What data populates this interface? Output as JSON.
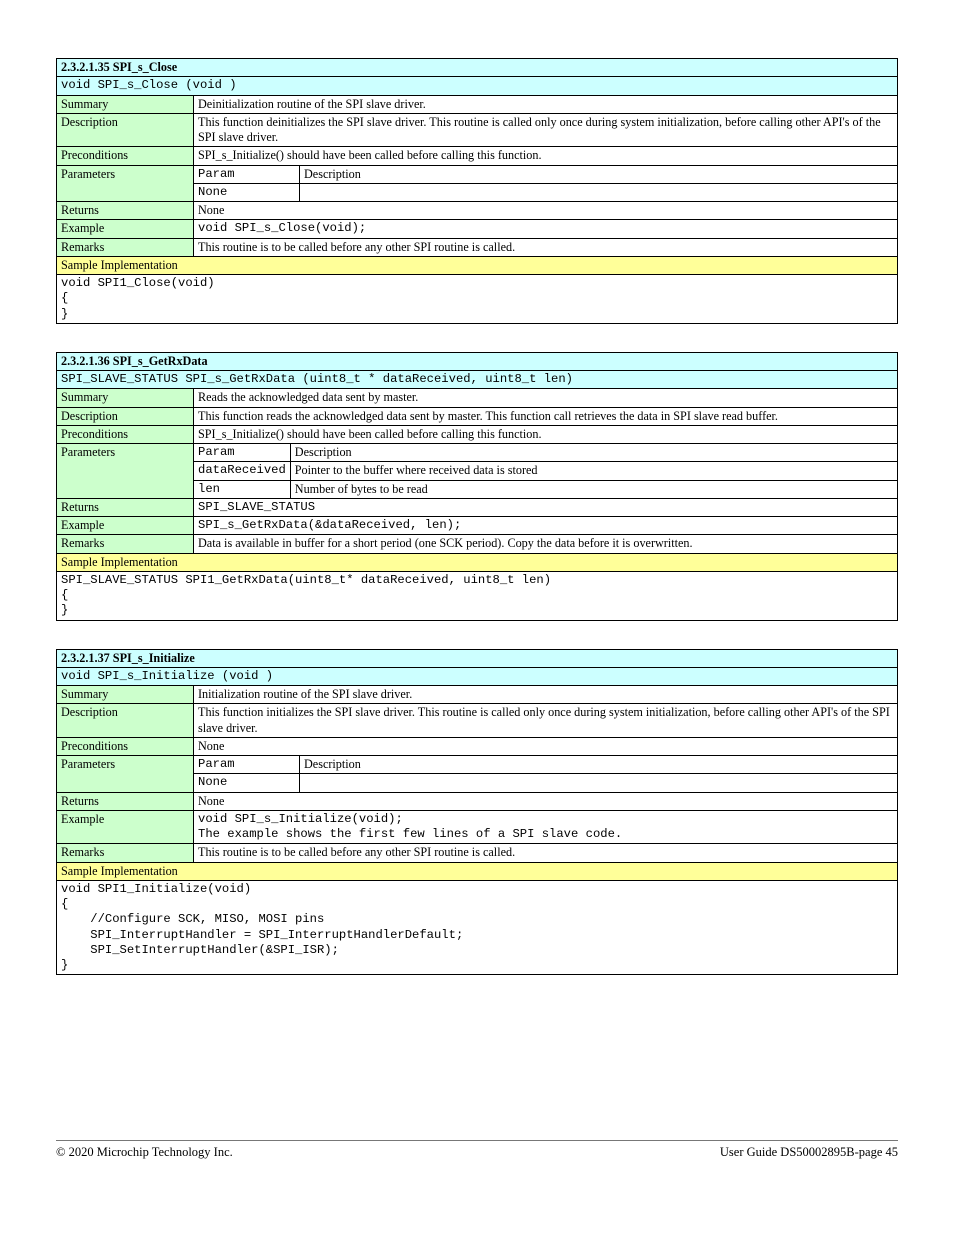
{
  "page": {
    "footer_left": "© 2020 Microchip Technology Inc.",
    "footer_right": "User Guide  DS50002895B-page 45"
  },
  "blocks": [
    {
      "title": "2.3.2.1.35 SPI_s_Close",
      "prototype": "void SPI_s_Close (void )",
      "rows": [
        {
          "label": "Summary",
          "value": "Deinitialization routine of the SPI slave driver."
        },
        {
          "label": "Description",
          "value": "This function deinitializes the SPI slave driver. This routine is called only once during system initialization, before calling other API's of the SPI slave driver."
        },
        {
          "label": "Preconditions",
          "value": "SPI_s_Initialize() should have been called before calling this function."
        },
        {
          "label": "Parameters",
          "params": [
            {
              "name": "Param",
              "type": "Description"
            },
            {
              "name": "None",
              "type": ""
            }
          ]
        },
        {
          "label": "Returns",
          "value": "None"
        },
        {
          "label": "Example",
          "value": "void SPI_s_Close(void);"
        },
        {
          "label": "Remarks",
          "value": "This routine is to be called before any other SPI routine is called."
        }
      ],
      "sample_header": "Sample Implementation",
      "sample_code": "void SPI1_Close(void)\n{\n}"
    },
    {
      "title": "2.3.2.1.36 SPI_s_GetRxData",
      "prototype": "SPI_SLAVE_STATUS SPI_s_GetRxData (uint8_t * dataReceived, uint8_t len)",
      "rows": [
        {
          "label": "Summary",
          "value": "Reads the acknowledged data sent by master."
        },
        {
          "label": "Description",
          "value": "This function reads the acknowledged data sent by master. This function call retrieves the data in SPI slave read buffer."
        },
        {
          "label": "Preconditions",
          "value": "SPI_s_Initialize() should have been called before calling this function."
        },
        {
          "label": "Parameters",
          "params": [
            {
              "name": "Param",
              "type": "Description"
            },
            {
              "name": "dataReceived",
              "type": "Pointer to the buffer where received data is stored"
            },
            {
              "name": "len",
              "type": "Number of bytes to be read"
            }
          ]
        },
        {
          "label": "Returns",
          "value": "SPI_SLAVE_STATUS"
        },
        {
          "label": "Example",
          "value": "SPI_s_GetRxData(&dataReceived, len);"
        },
        {
          "label": "Remarks",
          "value": "Data is available in buffer for a short period (one SCK period). Copy the data before it is overwritten."
        }
      ],
      "sample_header": "Sample Implementation",
      "sample_code": "SPI_SLAVE_STATUS SPI1_GetRxData(uint8_t* dataReceived, uint8_t len)\n{\n}"
    },
    {
      "title": "2.3.2.1.37 SPI_s_Initialize",
      "prototype": "void SPI_s_Initialize (void )",
      "rows": [
        {
          "label": "Summary",
          "value": "Initialization routine of the SPI slave driver."
        },
        {
          "label": "Description",
          "value": "This function initializes the SPI slave driver. This routine is called only once during system initialization, before calling other API's of the SPI slave driver."
        },
        {
          "label": "Preconditions",
          "value": "None"
        },
        {
          "label": "Parameters",
          "params": [
            {
              "name": "Param",
              "type": "Description"
            },
            {
              "name": "None",
              "type": ""
            }
          ]
        },
        {
          "label": "Returns",
          "value": "None"
        },
        {
          "label": "Example",
          "value": "void SPI_s_Initialize(void);\nThe example shows the first few lines of a SPI slave code."
        },
        {
          "label": "Remarks",
          "value": "This routine is to be called before any other SPI routine is called."
        }
      ],
      "sample_header": "Sample Implementation",
      "sample_code": "void SPI1_Initialize(void)\n{\n    //Configure SCK, MISO, MOSI pins\n    SPI_InterruptHandler = SPI_InterruptHandlerDefault;\n    SPI_SetInterruptHandler(&SPI_ISR);\n}"
    }
  ]
}
